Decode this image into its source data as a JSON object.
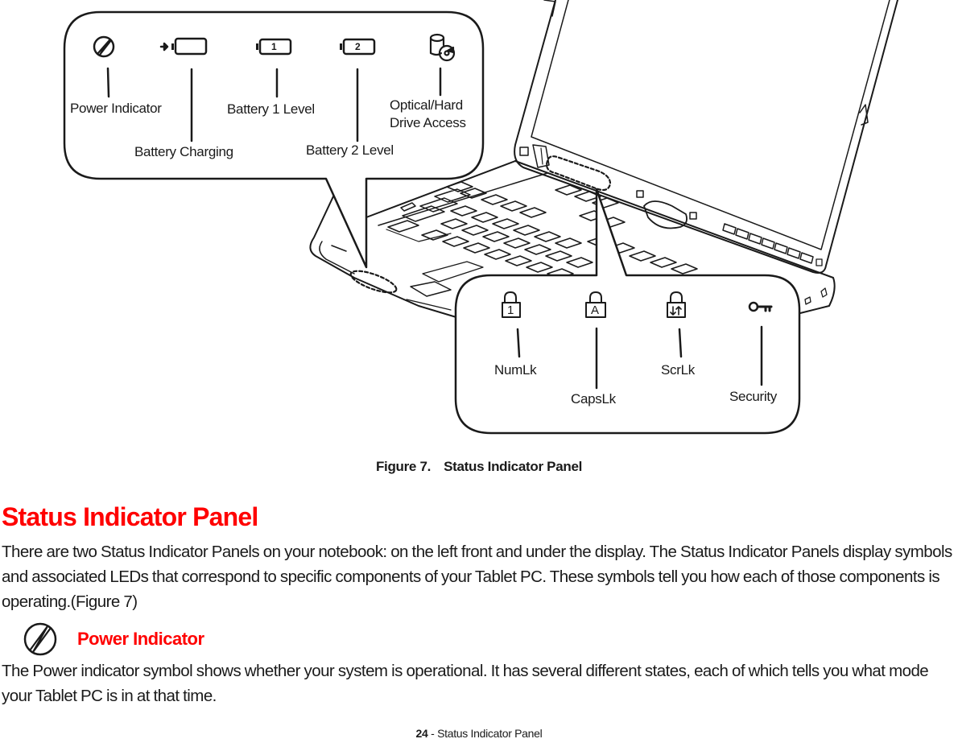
{
  "figure": {
    "top_callout": {
      "labels": [
        {
          "id": "power",
          "text": "Power Indicator",
          "icon": "power-icon"
        },
        {
          "id": "battery-charging",
          "text": "Battery Charging",
          "icon": "battery-charging-icon"
        },
        {
          "id": "battery-1",
          "text": "Battery 1 Level",
          "icon": "battery-1-icon",
          "icon_text": "1"
        },
        {
          "id": "battery-2",
          "text": "Battery 2 Level",
          "icon": "battery-2-icon",
          "icon_text": "2"
        },
        {
          "id": "drive-access",
          "text_line1": "Optical/Hard",
          "text_line2": "Drive Access",
          "icon": "drive-access-icon"
        }
      ]
    },
    "bottom_callout": {
      "labels": [
        {
          "id": "numlk",
          "text": "NumLk",
          "icon": "num-lock-icon",
          "icon_text": "1"
        },
        {
          "id": "capslk",
          "text": "CapsLk",
          "icon": "caps-lock-icon",
          "icon_text": "A"
        },
        {
          "id": "scrlk",
          "text": "ScrLk",
          "icon": "scroll-lock-icon"
        },
        {
          "id": "security",
          "text": "Security",
          "icon": "key-icon"
        }
      ]
    },
    "caption_number": "Figure 7.",
    "caption_title": "Status Indicator Panel"
  },
  "section": {
    "title": "Status Indicator Panel",
    "paragraph": "There are two Status Indicator Panels on your notebook: on the left front and under the display. The Status Indicator Panels display symbols and associated LEDs that correspond to specific components of your Tablet PC. These symbols tell you how each of those components is operating.(Figure 7)"
  },
  "subsection": {
    "icon": "power-icon",
    "title": "Power Indicator",
    "paragraph": "The Power indicator symbol shows whether your system is operational. It has several different states, each of which tells you what mode your Tablet PC is in at that time."
  },
  "footer": {
    "page_number": "24",
    "separator": " - ",
    "section": "Status Indicator Panel"
  },
  "colors": {
    "heading_red": "#ff0000",
    "line_art": "#1a1a1a"
  }
}
